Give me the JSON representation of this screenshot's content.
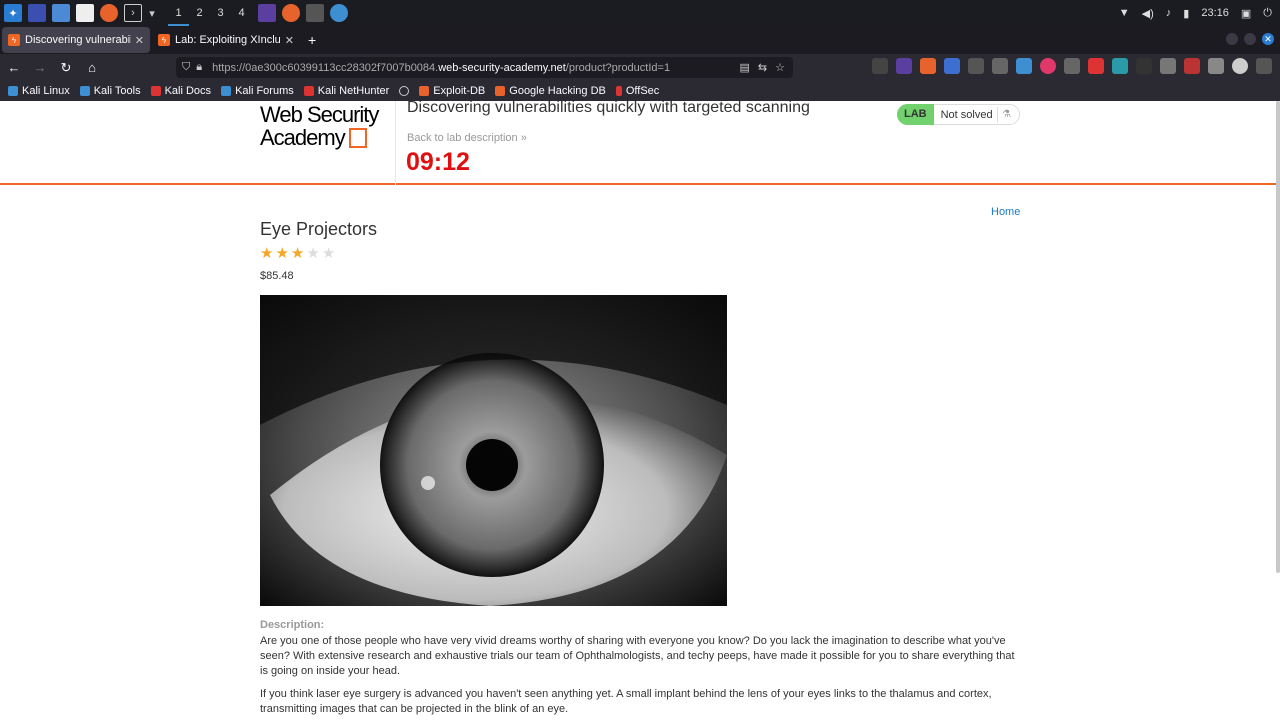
{
  "taskbar": {
    "workspaces": [
      "1",
      "2",
      "3",
      "4"
    ],
    "active_workspace": "1",
    "clock": "23:16"
  },
  "tabs": [
    {
      "title": "Discovering vulnerabilitie",
      "active": true
    },
    {
      "title": "Lab: Exploiting XInclude t",
      "active": false
    }
  ],
  "url": {
    "prefix": "https://0ae300c60399113cc28302f7007b0084.",
    "domain": "web-security-academy.net",
    "path": "/product?productId=1"
  },
  "bookmarks": [
    {
      "label": "Kali Linux",
      "icon": "kali-icon"
    },
    {
      "label": "Kali Tools",
      "icon": "kali-tools-icon"
    },
    {
      "label": "Kali Docs",
      "icon": "kali-docs-icon"
    },
    {
      "label": "Kali Forums",
      "icon": "kali-forums-icon"
    },
    {
      "label": "Kali NetHunter",
      "icon": "nethunter-icon"
    },
    {
      "label": "",
      "icon": "globe-icon"
    },
    {
      "label": "Exploit-DB",
      "icon": "exploit-db-icon"
    },
    {
      "label": "Google Hacking DB",
      "icon": "ghdb-icon"
    },
    {
      "label": "OffSec",
      "icon": "offsec-icon"
    }
  ],
  "header": {
    "logo_line1": "Web Security",
    "logo_line2": "Academy",
    "lab_title": "Discovering vulnerabilities quickly with targeted scanning",
    "back_link": "Back to lab description",
    "timer": "09:12",
    "lab_badge": "LAB",
    "lab_status": "Not solved"
  },
  "product": {
    "home_link": "Home",
    "title": "Eye Projectors",
    "rating": 3,
    "rating_max": 5,
    "price": "$85.48",
    "description_label": "Description:",
    "description": [
      "Are you one of those people who have very vivid dreams worthy of sharing with everyone you know? Do you lack the imagination to describe what you've seen? With extensive research and exhaustive trials our team of Ophthalmologists, and techy peeps, have made it possible for you to share everything that is going on inside your head.",
      "If you think laser eye surgery is advanced you haven't seen anything yet. A small implant behind the lens of your eyes links to the thalamus and cortex, transmitting images that can be projected in the blink of an eye."
    ]
  },
  "colors": {
    "accent": "#f26522",
    "timer": "#e01010",
    "link": "#1a7bc1",
    "lab_green": "#70d16d",
    "star": "#f5a623"
  }
}
